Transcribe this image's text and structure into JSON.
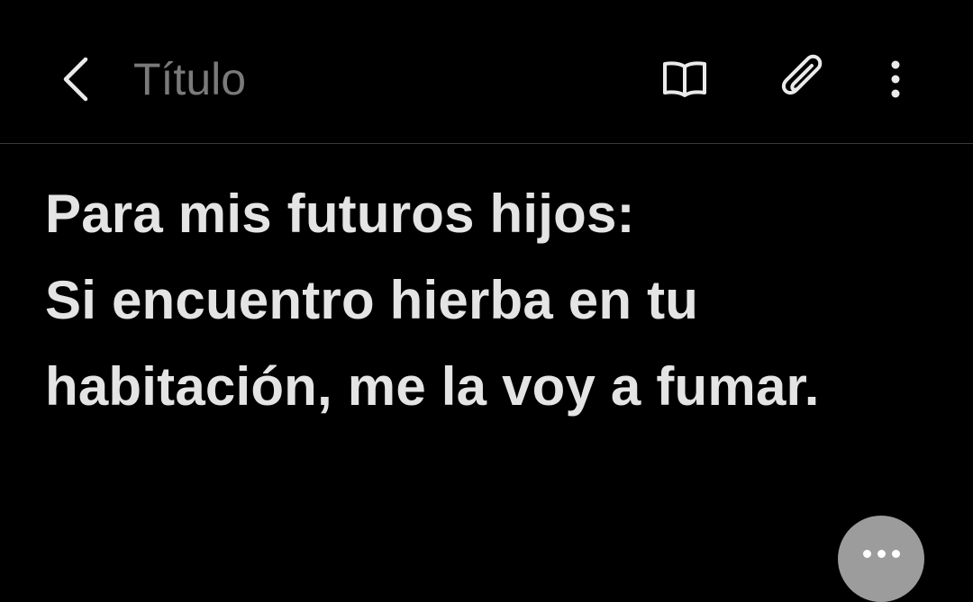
{
  "header": {
    "back_icon": "chevron-left-icon",
    "title_placeholder": "Título",
    "reader_icon": "open-book-icon",
    "attach_icon": "paperclip-icon",
    "more_icon": "vertical-dots-icon"
  },
  "note": {
    "lines": [
      "Para mis futuros hijos:",
      "Si encuentro hierba en tu",
      "habitación, me la voy a fumar."
    ]
  },
  "fab": {
    "icon": "more-horizontal-icon"
  },
  "colors": {
    "background": "#000000",
    "text": "#e4e4e4",
    "placeholder": "#7a7a7a",
    "divider": "#3a3a3a",
    "fab": "#9c9c9c"
  }
}
